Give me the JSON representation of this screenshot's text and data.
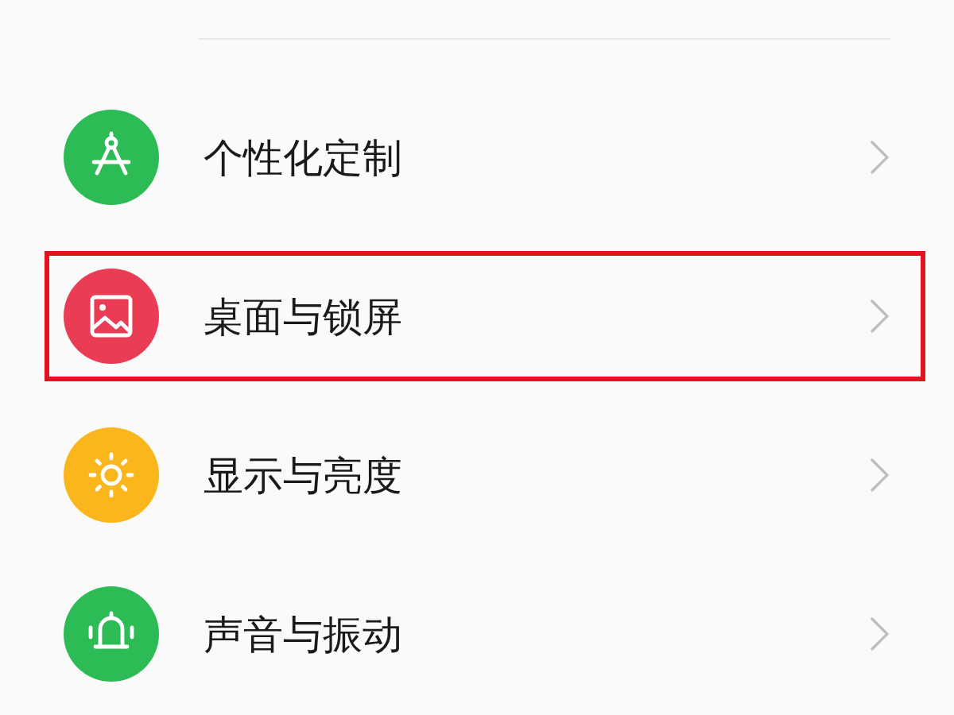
{
  "settings_items": [
    {
      "label": "个性化定制",
      "kind": "compass",
      "color": "#2dbb55",
      "highlighted": false
    },
    {
      "label": "桌面与锁屏",
      "kind": "image",
      "color": "#eb3c55",
      "highlighted": true
    },
    {
      "label": "显示与亮度",
      "kind": "sun",
      "color": "#fbb61c",
      "highlighted": false
    },
    {
      "label": "声音与振动",
      "kind": "bell",
      "color": "#2dbb55",
      "highlighted": false
    }
  ]
}
